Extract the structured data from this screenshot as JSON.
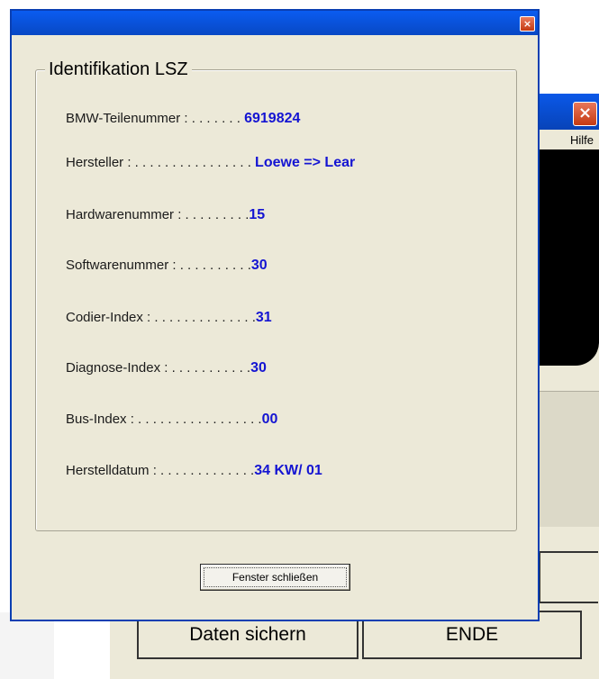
{
  "background_window": {
    "close_glyph": "×",
    "menu_help": "Hilfe",
    "save_button": "Daten sichern",
    "end_button": "ENDE"
  },
  "dialog": {
    "close_glyph": "×",
    "group_title": "Identifikation LSZ",
    "fields": [
      {
        "label": "BMW-Teilenummer : . . . . . . . ",
        "value": "6919824"
      },
      {
        "label": "Hersteller : . . . . . . . . . . . . . . . . ",
        "value": "Loewe => Lear"
      },
      {
        "label": "Hardwarenummer : . . . . . . . . .",
        "value": "15"
      },
      {
        "label": "Softwarenummer : . . . . . . . . . .",
        "value": "30"
      },
      {
        "label": "Codier-Index : . . . . . . . . . . . . . .",
        "value": "31"
      },
      {
        "label": "Diagnose-Index : . . . . . . . . . . .",
        "value": "30"
      },
      {
        "label": "Bus-Index : . . . . . . . . . . . . . . . . .",
        "value": "00"
      },
      {
        "label": "Herstelldatum : . . . . . . . . . . . . .",
        "value": "34  KW/ 01"
      }
    ],
    "close_button": "Fenster schließen"
  }
}
